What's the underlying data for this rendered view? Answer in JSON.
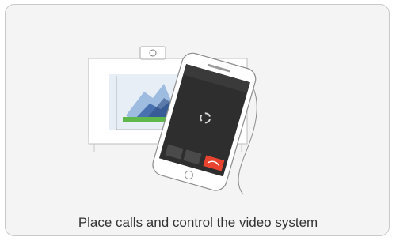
{
  "caption": "Place calls and control the video system",
  "colors": {
    "background": "#f4f4f4",
    "border": "#c9c9c9",
    "end_call_red": "#e8432f",
    "chart_blue": "#3a64a8",
    "chart_green": "#5fb84b",
    "chart_light_blue": "#7fa6d6"
  },
  "icons": [
    "video-system-camera-icon",
    "call-participant-icon",
    "end-call-icon",
    "loading-spinner-icon"
  ]
}
